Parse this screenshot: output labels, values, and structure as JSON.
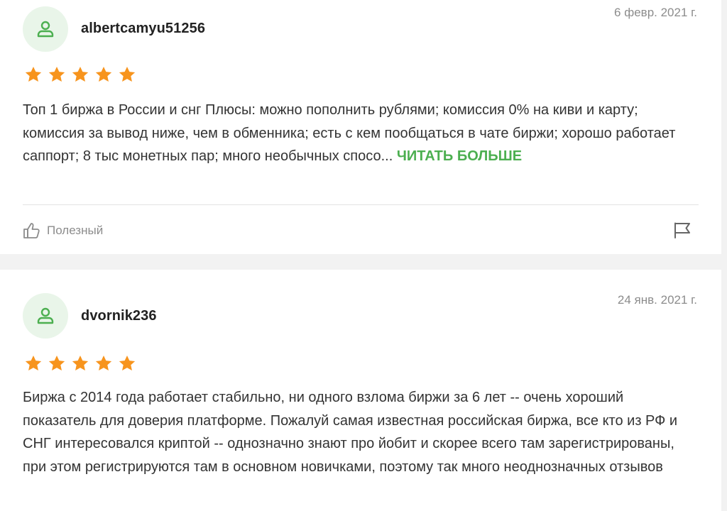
{
  "reviews": [
    {
      "username": "albertcamyu51256",
      "date": "6 февр. 2021 г.",
      "rating": 5,
      "text": "Топ 1 биржа в России и снг Плюсы: можно пополнить рублями; комиссия 0% на киви и карту; комиссия за вывод ниже, чем в обменника; есть с кем пообщаться в чате биржи; хорошо работает саппорт; 8 тыс монетных пар; много необычных спосо... ",
      "read_more": "Читать больше",
      "helpful_label": "Полезный"
    },
    {
      "username": "dvornik236",
      "date": "24 янв. 2021 г.",
      "rating": 5,
      "text": "Биржа с 2014 года работает стабильно, ни одного взлома биржи за 6 лет -- очень хороший показатель для доверия платформе. Пожалуй самая известная российская биржа, все кто из РФ и СНГ интересовался криптой -- однозначно знают про йобит и скорее всего там зарегистрированы, при этом регистрируются там в основном новичками, поэтому так много неоднозначных отзывов"
    }
  ],
  "colors": {
    "accent": "#4caf50",
    "star": "#f7941d",
    "avatar_bg": "#e9f5e9",
    "muted": "#8c8c8c"
  },
  "icons": {
    "avatar": "user-icon",
    "star": "star-icon",
    "helpful": "thumbs-up-icon",
    "report": "flag-icon"
  }
}
